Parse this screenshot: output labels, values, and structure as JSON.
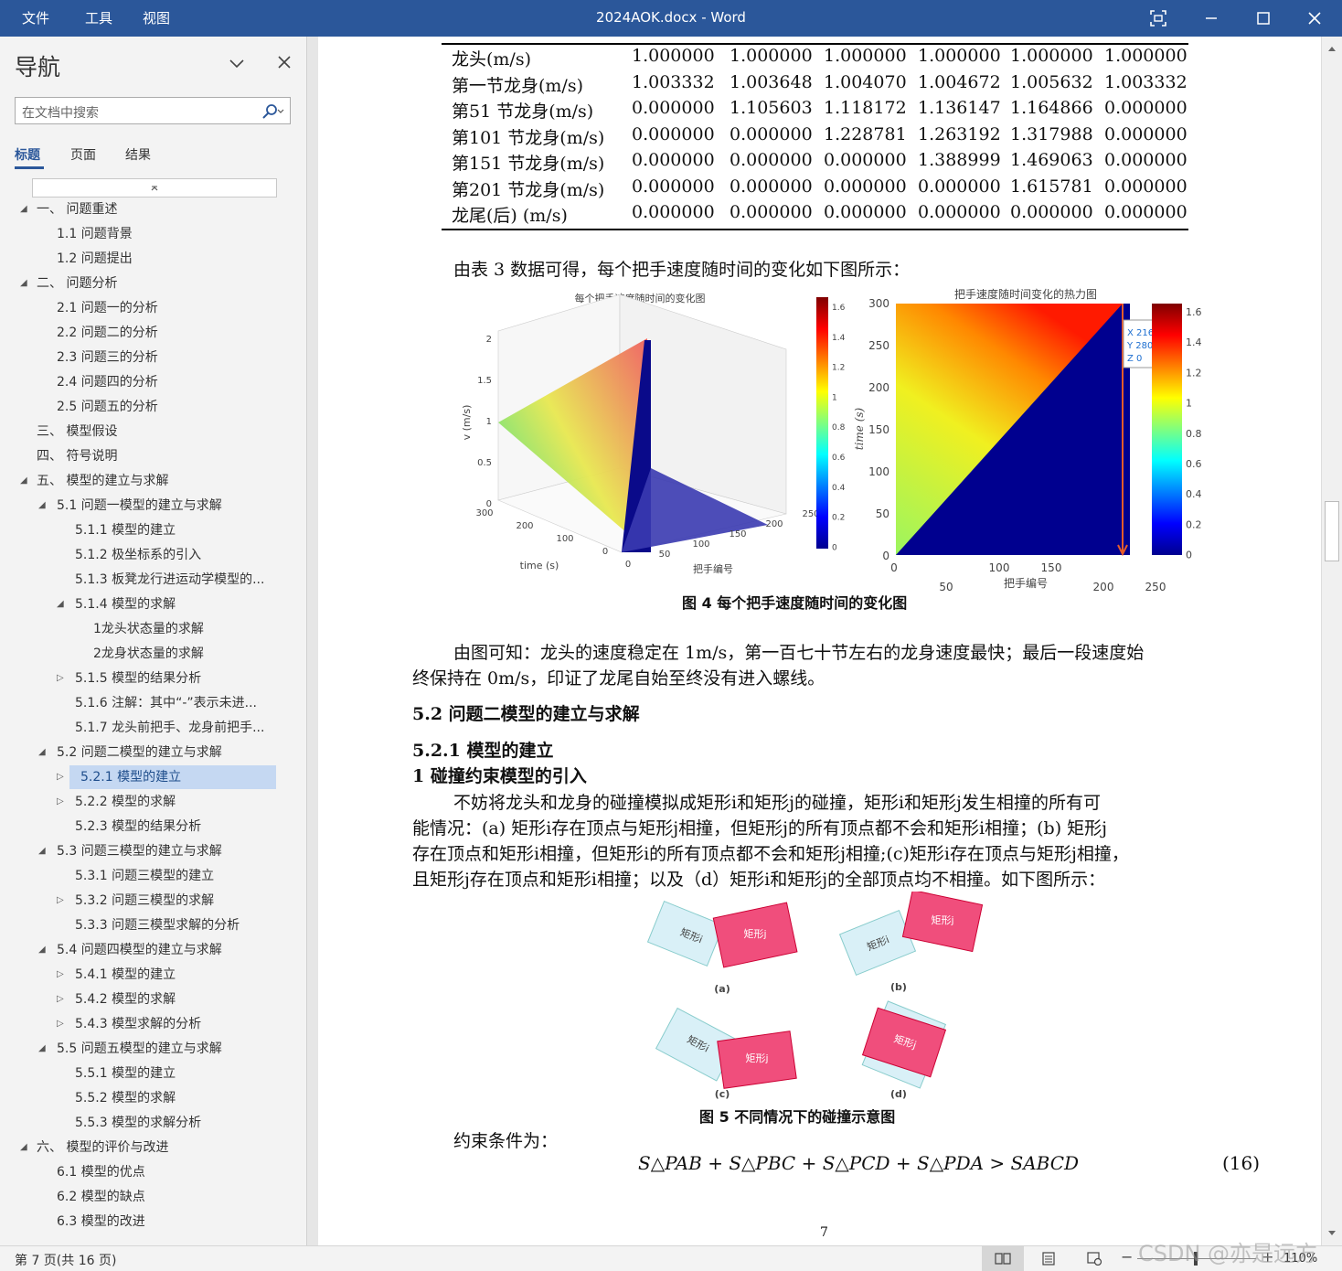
{
  "titlebar": {
    "menu": [
      "文件",
      "工具",
      "视图"
    ],
    "title": "2024AOK.docx  -  Word"
  },
  "nav": {
    "title": "导航",
    "search_placeholder": "在文档中搜索",
    "tabs": [
      "标题",
      "页面",
      "结果"
    ],
    "items": [
      {
        "label": "一、  问题重述",
        "level": 0,
        "tw": "open"
      },
      {
        "label": "1.1 问题背景",
        "level": 1,
        "tw": ""
      },
      {
        "label": "1.2 问题提出",
        "level": 1,
        "tw": ""
      },
      {
        "label": "二、  问题分析",
        "level": 0,
        "tw": "open"
      },
      {
        "label": "2.1 问题一的分析",
        "level": 1,
        "tw": ""
      },
      {
        "label": "2.2 问题二的分析",
        "level": 1,
        "tw": ""
      },
      {
        "label": "2.3 问题三的分析",
        "level": 1,
        "tw": ""
      },
      {
        "label": "2.4 问题四的分析",
        "level": 1,
        "tw": ""
      },
      {
        "label": "2.5 问题五的分析",
        "level": 1,
        "tw": ""
      },
      {
        "label": "三、  模型假设",
        "level": 0,
        "tw": ""
      },
      {
        "label": "四、  符号说明",
        "level": 0,
        "tw": ""
      },
      {
        "label": "五、  模型的建立与求解",
        "level": 0,
        "tw": "open"
      },
      {
        "label": "5.1 问题一模型的建立与求解",
        "level": 1,
        "tw": "open"
      },
      {
        "label": "5.1.1 模型的建立",
        "level": 2,
        "tw": ""
      },
      {
        "label": "5.1.2 极坐标系的引入",
        "level": 2,
        "tw": ""
      },
      {
        "label": "5.1.3 板凳龙行进运动学模型的...",
        "level": 2,
        "tw": ""
      },
      {
        "label": "5.1.4 模型的求解",
        "level": 2,
        "tw": "open"
      },
      {
        "label": "1龙头状态量的求解",
        "level": 3,
        "tw": ""
      },
      {
        "label": "2龙身状态量的求解",
        "level": 3,
        "tw": ""
      },
      {
        "label": "5.1.5 模型的结果分析",
        "level": 2,
        "tw": "closed"
      },
      {
        "label": "5.1.6 注解：其中“-”表示未进...",
        "level": 2,
        "tw": ""
      },
      {
        "label": "5.1.7 龙头前把手、龙身前把手...",
        "level": 2,
        "tw": ""
      },
      {
        "label": "5.2 问题二模型的建立与求解",
        "level": 1,
        "tw": "open"
      },
      {
        "label": "5.2.1 模型的建立",
        "level": 2,
        "tw": "closed",
        "selected": true
      },
      {
        "label": "5.2.2 模型的求解",
        "level": 2,
        "tw": "closed"
      },
      {
        "label": "5.2.3 模型的结果分析",
        "level": 2,
        "tw": ""
      },
      {
        "label": "5.3 问题三模型的建立与求解",
        "level": 1,
        "tw": "open"
      },
      {
        "label": "5.3.1 问题三模型的建立",
        "level": 2,
        "tw": ""
      },
      {
        "label": "5.3.2 问题三模型的求解",
        "level": 2,
        "tw": "closed"
      },
      {
        "label": "5.3.3 问题三模型求解的分析",
        "level": 2,
        "tw": ""
      },
      {
        "label": "5.4 问题四模型的建立与求解",
        "level": 1,
        "tw": "open"
      },
      {
        "label": "5.4.1 模型的建立",
        "level": 2,
        "tw": "closed"
      },
      {
        "label": "5.4.2 模型的求解",
        "level": 2,
        "tw": "closed"
      },
      {
        "label": "5.4.3 模型求解的分析",
        "level": 2,
        "tw": "closed"
      },
      {
        "label": "5.5 问题五模型的建立与求解",
        "level": 1,
        "tw": "open"
      },
      {
        "label": "5.5.1 模型的建立",
        "level": 2,
        "tw": ""
      },
      {
        "label": "5.5.2 模型的求解",
        "level": 2,
        "tw": ""
      },
      {
        "label": "5.5.3 模型的求解分析",
        "level": 2,
        "tw": ""
      },
      {
        "label": "六、  模型的评价与改进",
        "level": 0,
        "tw": "open"
      },
      {
        "label": "6.1 模型的优点",
        "level": 1,
        "tw": ""
      },
      {
        "label": "6.2 模型的缺点",
        "level": 1,
        "tw": ""
      },
      {
        "label": "6.3 模型的改进",
        "level": 1,
        "tw": ""
      }
    ]
  },
  "table": {
    "rows": [
      {
        "label": "龙头(m/s)",
        "values": [
          "1.000000",
          "1.000000",
          "1.000000",
          "1.000000",
          "1.000000",
          "1.000000"
        ]
      },
      {
        "label": "第一节龙身(m/s)",
        "values": [
          "1.003332",
          "1.003648",
          "1.004070",
          "1.004672",
          "1.005632",
          "1.003332"
        ]
      },
      {
        "label": "第51 节龙身(m/s)",
        "values": [
          "0.000000",
          "1.105603",
          "1.118172",
          "1.136147",
          "1.164866",
          "0.000000"
        ]
      },
      {
        "label": "第101 节龙身(m/s)",
        "values": [
          "0.000000",
          "0.000000",
          "1.228781",
          "1.263192",
          "1.317988",
          "0.000000"
        ]
      },
      {
        "label": "第151 节龙身(m/s)",
        "values": [
          "0.000000",
          "0.000000",
          "0.000000",
          "1.388999",
          "1.469063",
          "0.000000"
        ]
      },
      {
        "label": "第201 节龙身(m/s)",
        "values": [
          "0.000000",
          "0.000000",
          "0.000000",
          "0.000000",
          "1.615781",
          "0.000000"
        ]
      },
      {
        "label": "龙尾(后) (m/s)",
        "values": [
          "0.000000",
          "0.000000",
          "0.000000",
          "0.000000",
          "0.000000",
          "0.000000"
        ]
      }
    ]
  },
  "doc": {
    "para1": "由表 3 数据可得，每个把手速度随时间的变化如下图所示：",
    "fig4_caption": "图 4  每个把手速度随时间的变化图",
    "para2_line1": "由图可知：龙头的速度稳定在 1m/s，第一百七十节左右的龙身速度最快；最后一段速度始",
    "para2_line2": "终保持在 0m/s，印证了龙尾自始至终没有进入螺线。",
    "h52": "5.2 问题二模型的建立与求解",
    "h521": "5.2.1 模型的建立",
    "h_collision": "1 碰撞约束模型的引入",
    "para3_line1": "不妨将龙头和龙身的碰撞模拟成矩形i和矩形j的碰撞，矩形i和矩形j发生相撞的所有可",
    "para3_line2": "能情况：(a) 矩形i存在顶点与矩形j相撞，但矩形j的所有顶点都不会和矩形i相撞；(b) 矩形j",
    "para3_line3": "存在顶点和矩形i相撞，但矩形i的所有顶点都不会和矩形j相撞;(c)矩形i存在顶点与矩形j相撞，",
    "para3_line4": "且矩形j存在顶点和矩形i相撞；以及（d）矩形i和矩形j的全部顶点均不相撞。如下图所示：",
    "fig5_caption": "图 5  不同情况下的碰撞示意图",
    "constraint": "约束条件为：",
    "formula": "S△PAB + S△PBC + S△PCD + S△PDA > SABCD",
    "eq_no": "(16)",
    "page_no": "7"
  },
  "fig4": {
    "left_title": "每个把手速度随时间的变化图",
    "left_zlabel": "v (m/s)",
    "left_xlabel": "time (s)",
    "left_ylabel": "把手编号",
    "left_zticks": [
      "2",
      "1.5",
      "1",
      "0.5",
      "0"
    ],
    "left_timeticks": [
      "300",
      "200",
      "100",
      "0"
    ],
    "left_handleticks": [
      "0",
      "50",
      "100",
      "150",
      "200",
      "250"
    ],
    "left_cbar_ticks": [
      "1.6",
      "1.4",
      "1.2",
      "1",
      "0.8",
      "0.6",
      "0.4",
      "0.2",
      "0"
    ],
    "right_title": "把手速度随时间变化的热力图",
    "right_ylabel": "time (s)",
    "right_xlabel": "把手编号",
    "right_yticks": [
      "300",
      "250",
      "200",
      "150",
      "100",
      "50",
      "0"
    ],
    "right_xticks": [
      "0",
      "50",
      "100",
      "150",
      "200",
      "250"
    ],
    "right_cbar_ticks": [
      "1.6",
      "1.4",
      "1.2",
      "1",
      "0.8",
      "0.6",
      "0.4",
      "0.2",
      "0"
    ],
    "datatip": [
      "X 216",
      "Y 280",
      "Z 0"
    ]
  },
  "fig5": {
    "rect_i": "矩形i",
    "rect_j": "矩形j",
    "labels": [
      "(a)",
      "(b)",
      "(c)",
      "(d)"
    ]
  },
  "status": {
    "page_info": "第 7 页(共 16 页)",
    "zoom": "110%",
    "watermark": "CSDN @亦是远方"
  }
}
